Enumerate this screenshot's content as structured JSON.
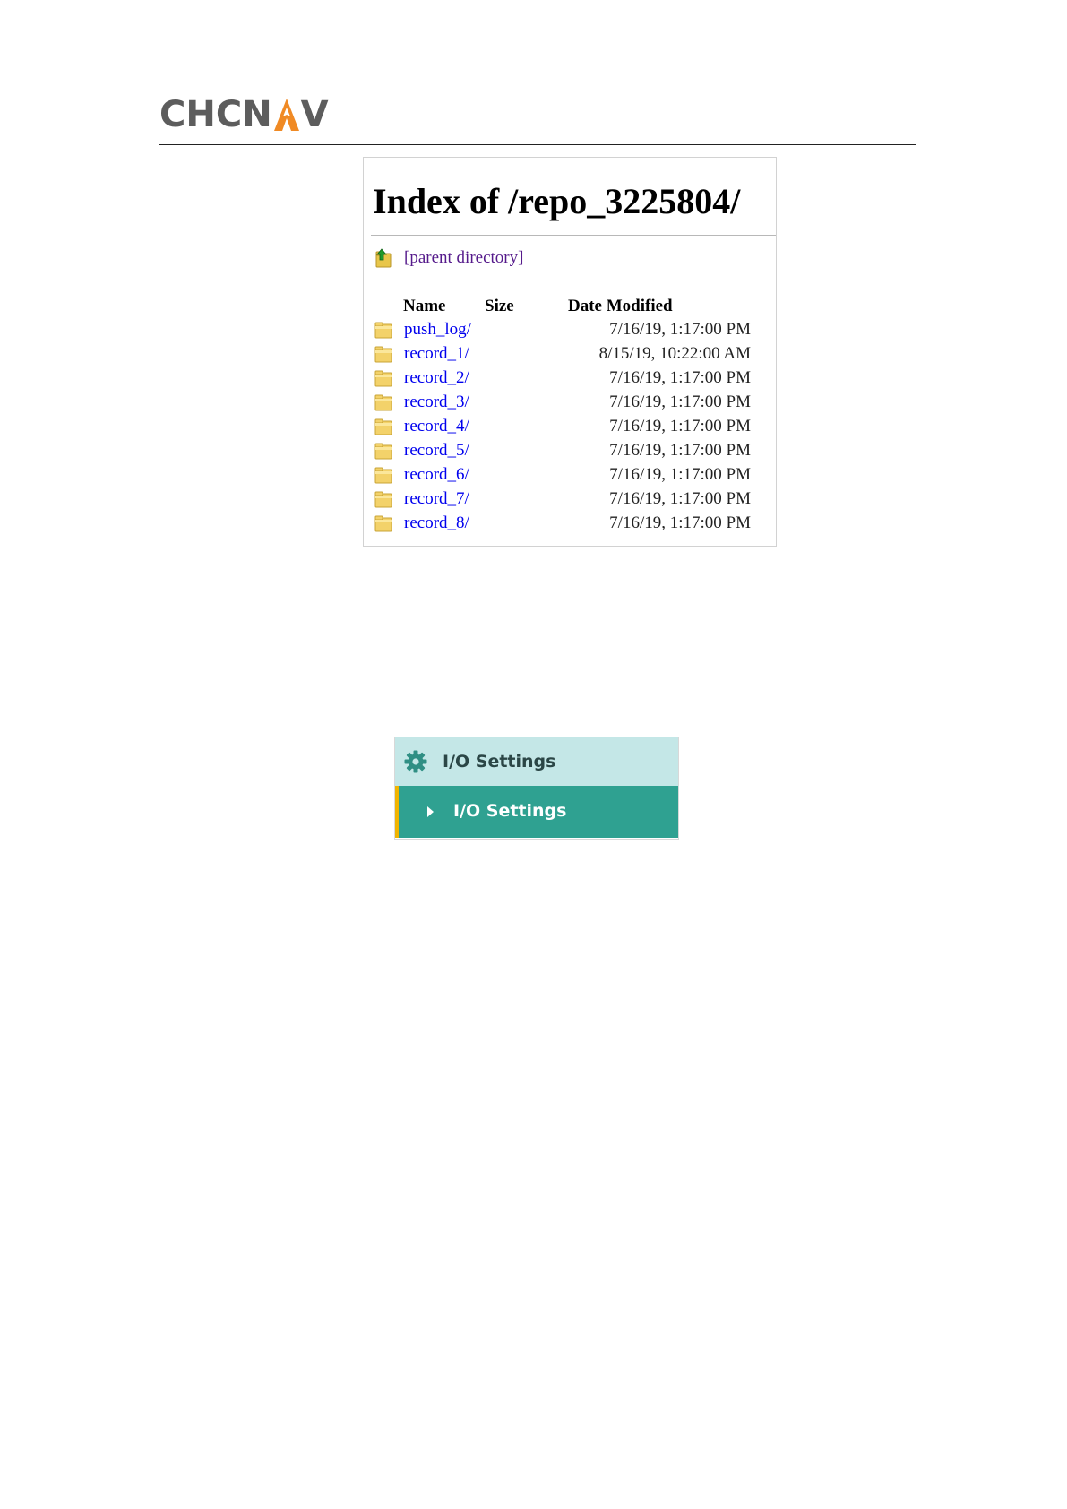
{
  "header": {
    "logo_text_left": "CHCN",
    "logo_text_right": "V",
    "logo_text": "CHCNAV",
    "logo_color": "#5d5d5d",
    "logo_accent_color": "#f08a24"
  },
  "listing": {
    "title": "Index of /repo_3225804/",
    "parent_label": "[parent directory]",
    "columns": {
      "name": "Name",
      "size": "Size",
      "date": "Date Modified"
    },
    "rows": [
      {
        "name": "push_log/",
        "size": "",
        "date": "7/16/19, 1:17:00 PM"
      },
      {
        "name": "record_1/",
        "size": "",
        "date": "8/15/19, 10:22:00 AM"
      },
      {
        "name": "record_2/",
        "size": "",
        "date": "7/16/19, 1:17:00 PM"
      },
      {
        "name": "record_3/",
        "size": "",
        "date": "7/16/19, 1:17:00 PM"
      },
      {
        "name": "record_4/",
        "size": "",
        "date": "7/16/19, 1:17:00 PM"
      },
      {
        "name": "record_5/",
        "size": "",
        "date": "7/16/19, 1:17:00 PM"
      },
      {
        "name": "record_6/",
        "size": "",
        "date": "7/16/19, 1:17:00 PM"
      },
      {
        "name": "record_7/",
        "size": "",
        "date": "7/16/19, 1:17:00 PM"
      },
      {
        "name": "record_8/",
        "size": "",
        "date": "7/16/19, 1:17:00 PM"
      }
    ],
    "link_color": "#0000ee",
    "visited_color": "#551a8b",
    "folder_icon": "folder-icon",
    "parent_icon": "up-arrow-folder-icon"
  },
  "menu": {
    "header_label": "I/O Settings",
    "header_icon": "gear-icon",
    "item_label": "I/O Settings",
    "item_icon": "caret-right-icon",
    "header_bg": "#c4e7e7",
    "item_bg": "#2fa191",
    "item_accent": "#f0b400"
  }
}
